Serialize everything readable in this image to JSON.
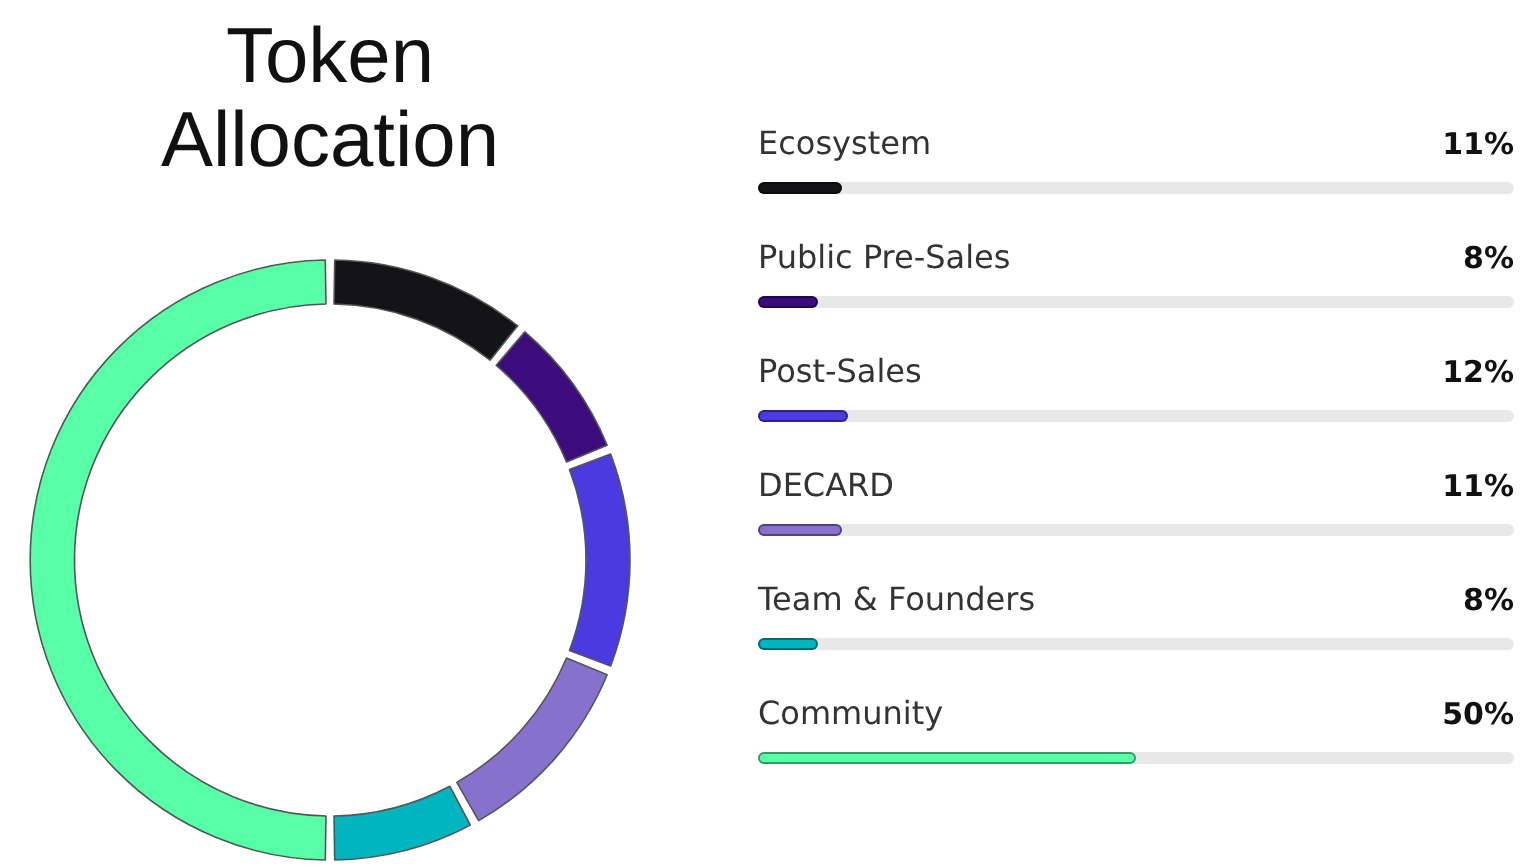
{
  "title": "Token Allocation",
  "allocations": [
    {
      "name": "Ecosystem",
      "reading": "11%",
      "level": 0.11,
      "color": "#141416"
    },
    {
      "name": "Public Pre-Sales",
      "reading": "8%",
      "level": 0.08,
      "color": "#3d0c7c"
    },
    {
      "name": "Post-Sales",
      "reading": "12%",
      "level": 0.12,
      "color": "#4b3ae0"
    },
    {
      "name": "DECARD",
      "reading": "11%",
      "level": 0.11,
      "color": "#8672cc"
    },
    {
      "name": "Team & Founders",
      "reading": "8%",
      "level": 0.08,
      "color": "#00b5be"
    },
    {
      "name": "Community",
      "reading": "50%",
      "level": 0.5,
      "color": "#57ffa6"
    }
  ]
}
